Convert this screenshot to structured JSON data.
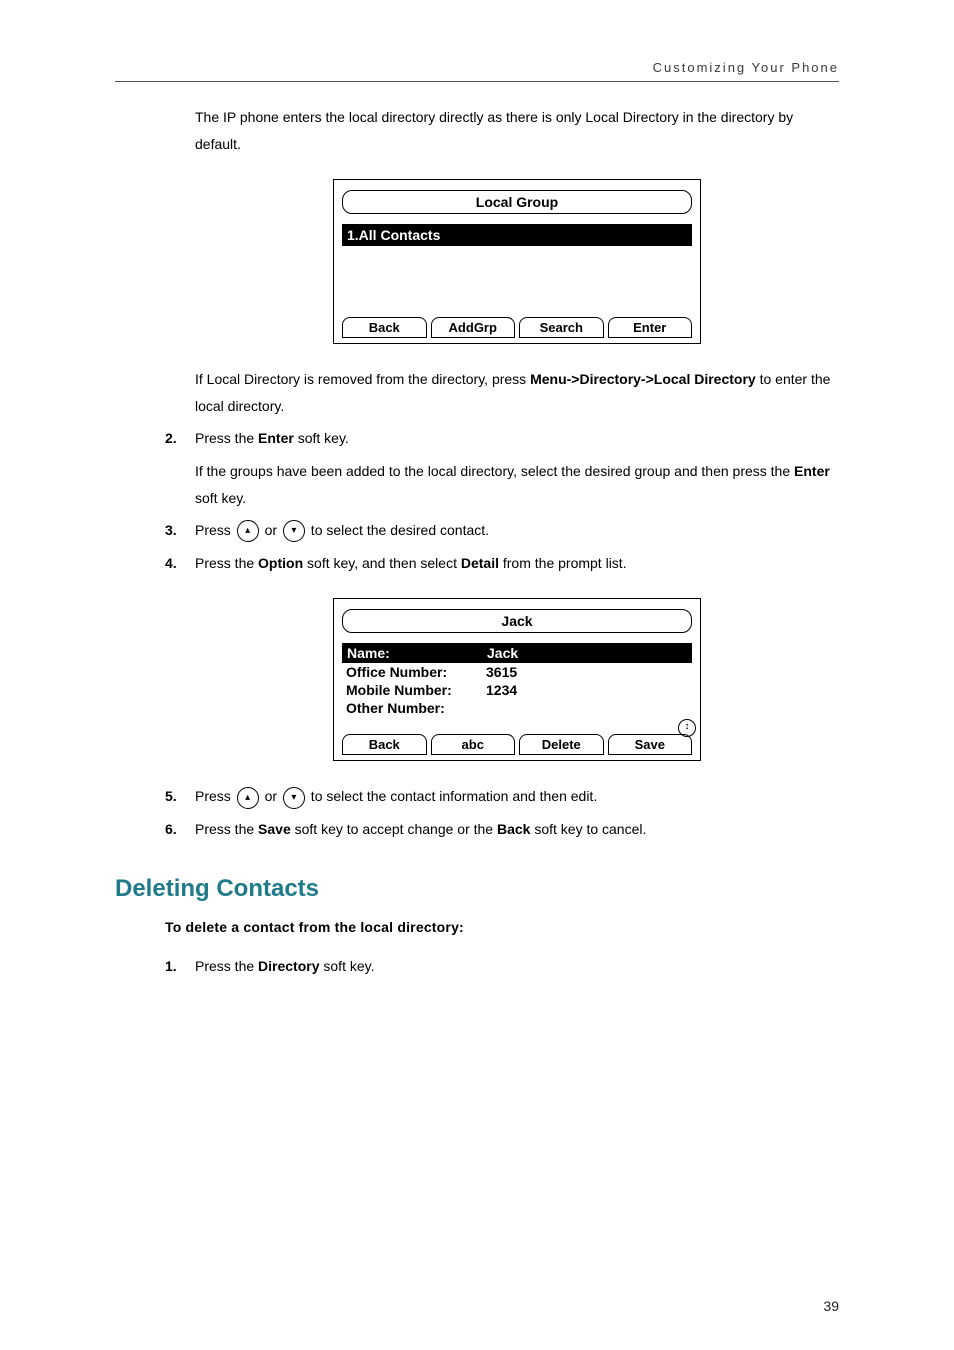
{
  "header": {
    "running_head": "Customizing Your Phone"
  },
  "intro": "The IP phone enters the local directory directly as there is only Local Directory in the directory by default.",
  "figure1": {
    "title": "Local Group",
    "selected_item": "1.All Contacts",
    "softkeys": [
      "Back",
      "AddGrp",
      "Search",
      "Enter"
    ]
  },
  "after_fig1_a": "If Local Directory is removed from the directory, press ",
  "after_fig1_path": "Menu->Directory->Local Directory",
  "after_fig1_b": " to enter the local directory.",
  "steps_a": [
    {
      "n": "2.",
      "pre": "Press the ",
      "bold": "Enter",
      "post": " soft key.",
      "body": "If the groups have been added to the local directory, select the desired group and then press the ",
      "body_bold": "Enter",
      "body_post": " soft key."
    },
    {
      "n": "3.",
      "text": "Press __UP__ or __DOWN__ to select the desired contact."
    },
    {
      "n": "4.",
      "pre": "Press the ",
      "bold": "Option",
      "mid": " soft key, and then select ",
      "bold2": "Detail",
      "post": " from the prompt list."
    }
  ],
  "figure2": {
    "title": "Jack",
    "rows": [
      {
        "label": "Name:",
        "value": "Jack",
        "selected": true
      },
      {
        "label": "Office Number:",
        "value": "3615"
      },
      {
        "label": "Mobile Number:",
        "value": "1234"
      },
      {
        "label": "Other Number:",
        "value": ""
      }
    ],
    "softkeys": [
      "Back",
      "abc",
      "Delete",
      "Save"
    ]
  },
  "steps_b": [
    {
      "n": "5.",
      "text": "Press __UP__ or __DOWN__ to select the contact information and then edit."
    },
    {
      "n": "6.",
      "pre": "Press the ",
      "bold": "Save",
      "mid": " soft key to accept change or the ",
      "bold2": "Back",
      "post": " soft key to cancel."
    }
  ],
  "section_title": "Deleting Contacts",
  "subheading": "To delete a contact from the local directory:",
  "steps_c": [
    {
      "n": "1.",
      "pre": "Press the ",
      "bold": "Directory",
      "post": " soft key."
    }
  ],
  "page_number": "39",
  "icons": {
    "up": "▴",
    "down": "▾",
    "scroll": "↕"
  }
}
